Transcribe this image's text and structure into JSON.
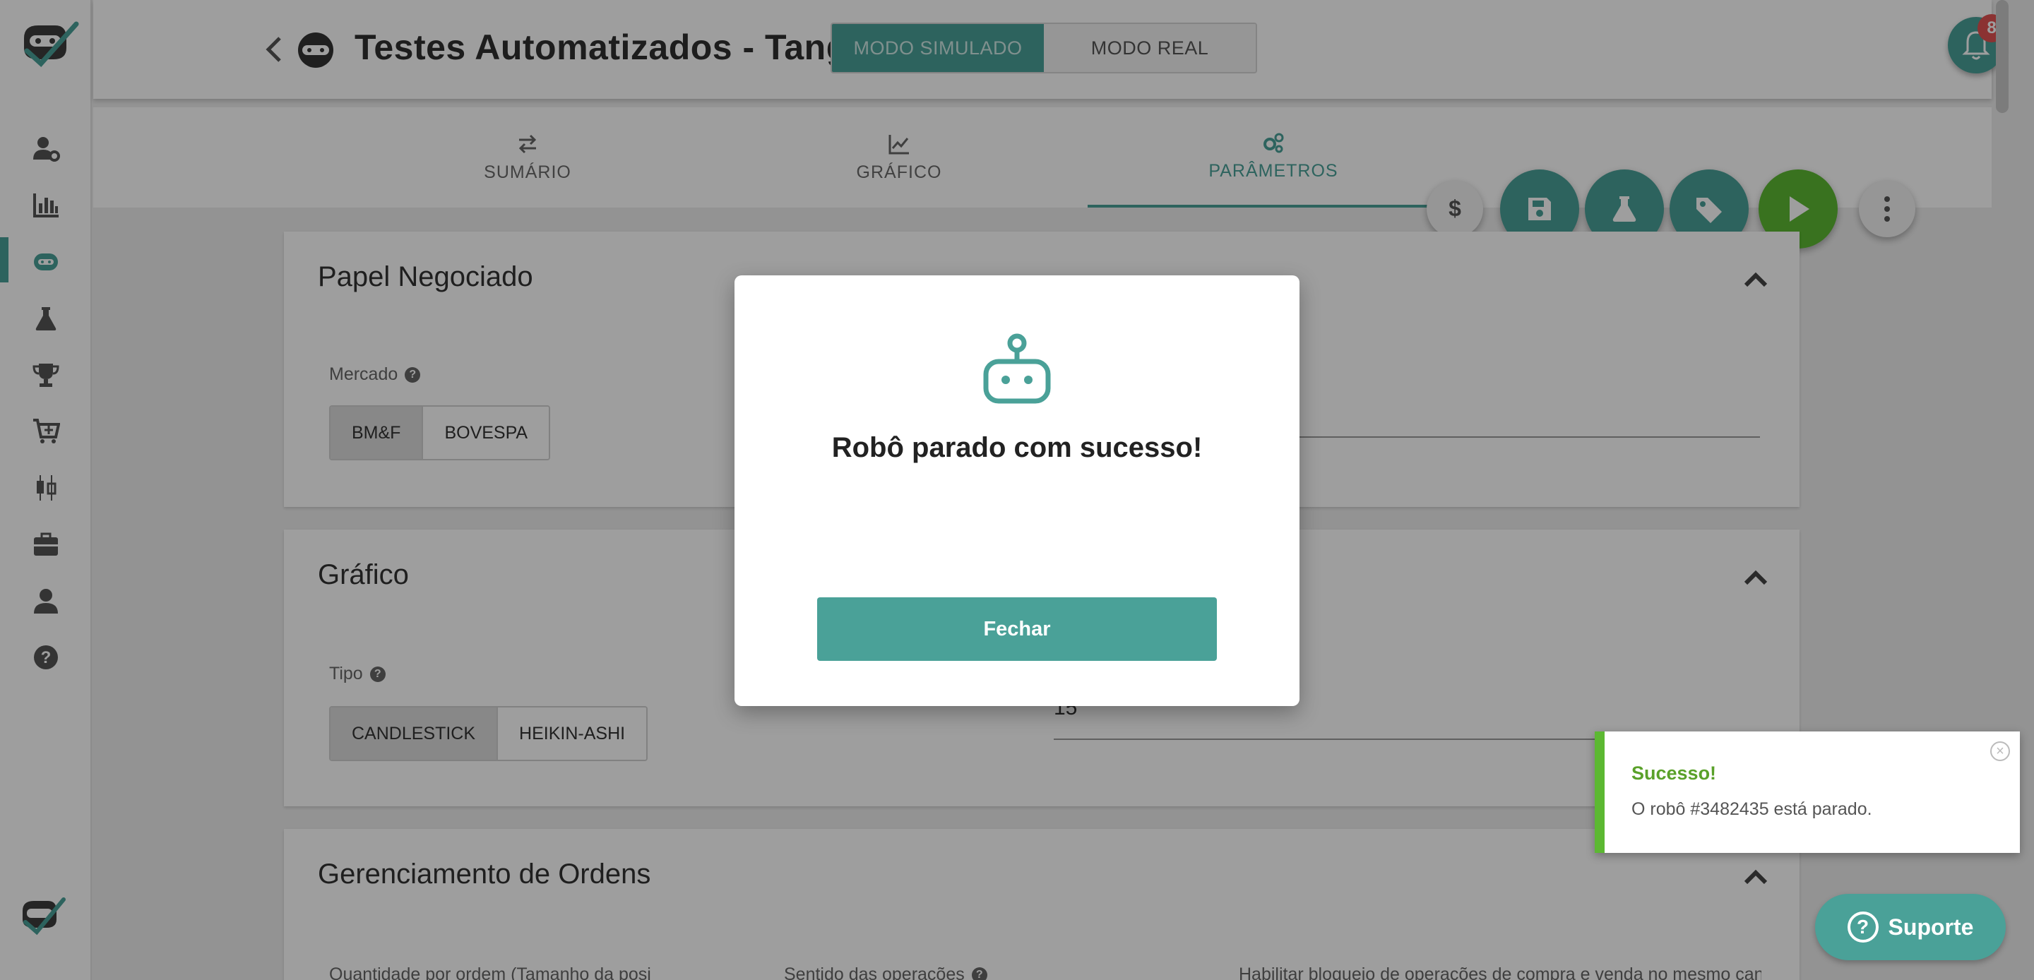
{
  "colors": {
    "accent": "#4aa198",
    "play": "#5cb832",
    "danger": "#e05252"
  },
  "header": {
    "title": "Testes Automatizados - Tangram",
    "mode_simulated": "MODO SIMULADO",
    "mode_real": "MODO REAL",
    "notifications_count": "8"
  },
  "sidebar": {
    "icons": [
      "user-gear-icon",
      "bar-chart-icon",
      "robot-icon",
      "flask-icon",
      "trophy-icon",
      "cart-plus-icon",
      "candlestick-icon",
      "briefcase-icon",
      "user-icon",
      "help-icon"
    ],
    "active_item": "robot-icon"
  },
  "tabs": [
    {
      "label": "SUMÁRIO",
      "icon": "exchange-icon"
    },
    {
      "label": "GRÁFICO",
      "icon": "line-chart-icon"
    },
    {
      "label": "PARÂMETROS",
      "icon": "gears-icon"
    }
  ],
  "fabs": [
    "dollar-icon",
    "save-icon",
    "flask-icon",
    "tag-icon",
    "play-icon",
    "more-vertical-icon"
  ],
  "cards": {
    "papel": {
      "title": "Papel Negociado",
      "mercado_label": "Mercado",
      "mercado_options": [
        "BM&F",
        "BOVESPA"
      ],
      "mercado_selected": "BM&F"
    },
    "grafico": {
      "title": "Gráfico",
      "tipo_label": "Tipo",
      "tipo_options": [
        "CANDLESTICK",
        "HEIKIN-ASHI"
      ],
      "tipo_selected": "CANDLESTICK",
      "periodo_value": "15"
    },
    "ordens": {
      "title": "Gerenciamento de Ordens",
      "qty_label": "Quantidade por ordem (Tamanho da posi",
      "sentido_label": "Sentido das operações",
      "right_label": "Habilitar bloqueio de operações de compra e venda no mesmo candle"
    }
  },
  "modal": {
    "title": "Robô parado com sucesso!",
    "button_label": "Fechar"
  },
  "toast": {
    "title": "Sucesso!",
    "message": "O robô #3482435 está parado."
  },
  "support": {
    "label": "Suporte"
  }
}
